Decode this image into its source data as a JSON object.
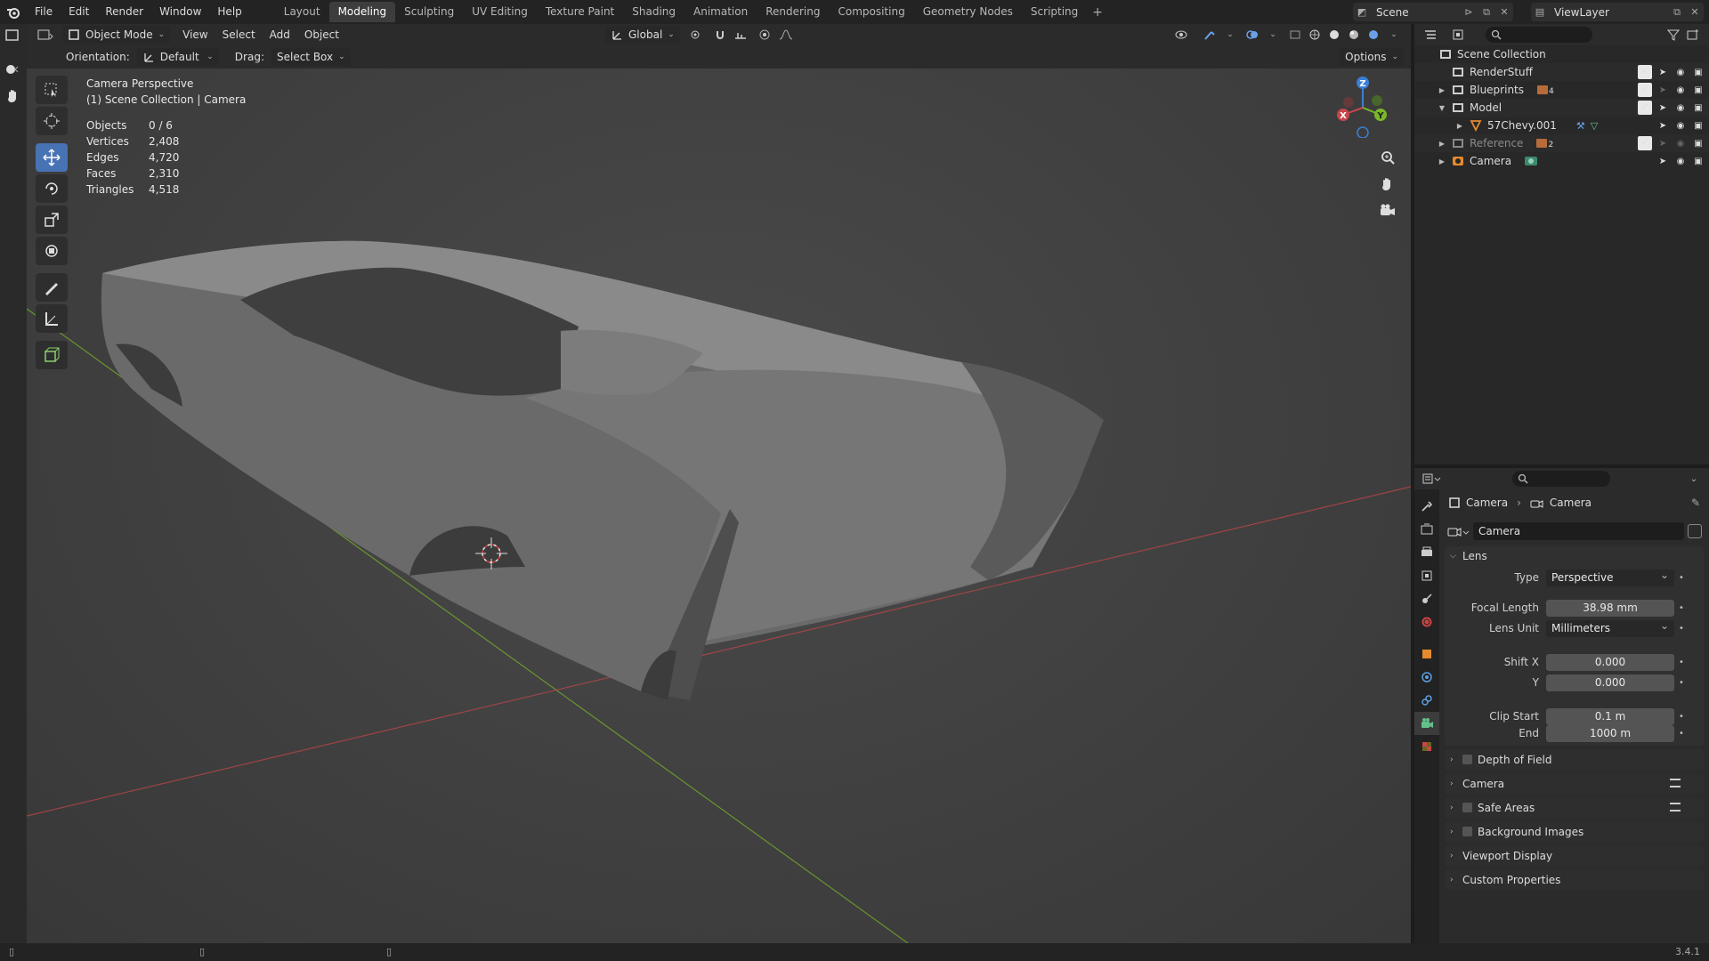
{
  "menu": [
    "File",
    "Edit",
    "Render",
    "Window",
    "Help"
  ],
  "workspaces": [
    {
      "label": "Layout",
      "active": false
    },
    {
      "label": "Modeling",
      "active": true
    },
    {
      "label": "Sculpting",
      "active": false
    },
    {
      "label": "UV Editing",
      "active": false
    },
    {
      "label": "Texture Paint",
      "active": false
    },
    {
      "label": "Shading",
      "active": false
    },
    {
      "label": "Animation",
      "active": false
    },
    {
      "label": "Rendering",
      "active": false
    },
    {
      "label": "Compositing",
      "active": false
    },
    {
      "label": "Geometry Nodes",
      "active": false
    },
    {
      "label": "Scripting",
      "active": false
    }
  ],
  "scene": {
    "name": "Scene",
    "view_layer": "ViewLayer"
  },
  "viewport_header": {
    "mode": "Object Mode",
    "menus": [
      "View",
      "Select",
      "Add",
      "Object"
    ],
    "transform": "Global",
    "orientation_label": "Orientation:",
    "orientation_value": "Default",
    "drag_label": "Drag:",
    "drag_value": "Select Box",
    "options": "Options"
  },
  "viewport": {
    "title": "Camera Perspective",
    "subtitle": "(1) Scene Collection | Camera",
    "stats": [
      {
        "k": "Objects",
        "v": "0 / 6"
      },
      {
        "k": "Vertices",
        "v": "2,408"
      },
      {
        "k": "Edges",
        "v": "4,720"
      },
      {
        "k": "Faces",
        "v": "2,310"
      },
      {
        "k": "Triangles",
        "v": "4,518"
      }
    ],
    "gizmo": {
      "x": "X",
      "y": "Y",
      "z": "Z"
    }
  },
  "outliner": {
    "root": "Scene Collection",
    "rows": [
      {
        "name": "RenderStuff",
        "indent": 1,
        "dim": false
      },
      {
        "name": "Blueprints",
        "indent": 1,
        "dim": false,
        "badge": "4"
      },
      {
        "name": "Model",
        "indent": 1,
        "dim": false
      },
      {
        "name": "57Chevy.001",
        "indent": 2,
        "dim": false
      },
      {
        "name": "Reference",
        "indent": 1,
        "dim": true,
        "badge": "2"
      },
      {
        "name": "Camera",
        "indent": 1,
        "dim": false
      }
    ]
  },
  "properties": {
    "breadcrumb_object": "Camera",
    "breadcrumb_data": "Camera",
    "datablock": "Camera",
    "lens_panel": "Lens",
    "type_label": "Type",
    "type_value": "Perspective",
    "focal_label": "Focal Length",
    "focal_value": "38.98 mm",
    "lens_unit_label": "Lens Unit",
    "lens_unit_value": "Millimeters",
    "shift_x_label": "Shift X",
    "shift_x_value": "0.000",
    "shift_y_label": "Y",
    "shift_y_value": "0.000",
    "clip_start_label": "Clip Start",
    "clip_start_value": "0.1 m",
    "clip_end_label": "End",
    "clip_end_value": "1000 m",
    "subpanels": [
      "Depth of Field",
      "Camera",
      "Safe Areas",
      "Background Images",
      "Viewport Display",
      "Custom Properties"
    ]
  },
  "status": {
    "version": "3.4.1"
  },
  "colors": {
    "accent": "#4772b3",
    "x_axis": "#c8464a",
    "y_axis": "#7ab829",
    "z_axis": "#3b7fd6"
  }
}
